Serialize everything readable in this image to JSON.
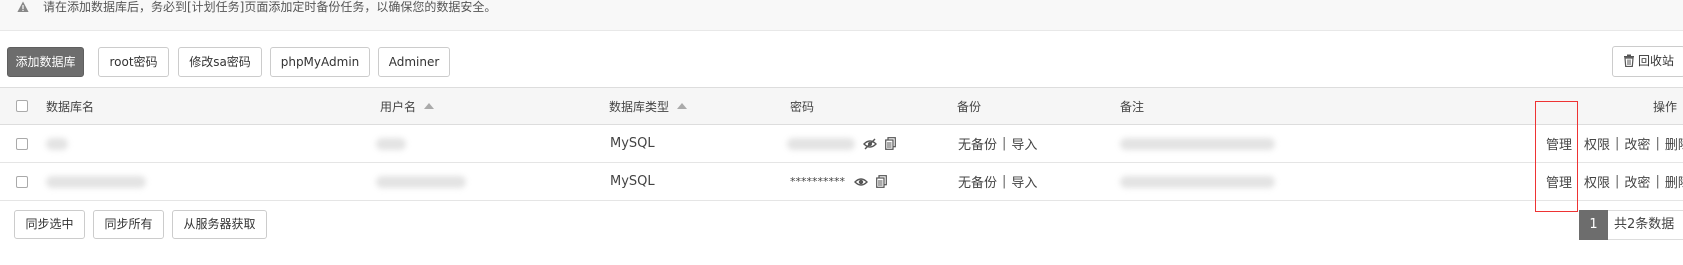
{
  "notice": {
    "icon": "warning-icon",
    "text": "请在添加数据库后，务必到[计划任务]页面添加定时备份任务，以确保您的数据安全。"
  },
  "toolbar": {
    "add_db": "添加数据库",
    "root_pwd": "root密码",
    "sa_pwd": "修改sa密码",
    "phpmyadmin": "phpMyAdmin",
    "adminer": "Adminer",
    "recycle": "回收站",
    "recycle_icon": "trash-icon"
  },
  "table": {
    "headers": {
      "name": "数据库名",
      "user": "用户名",
      "type": "数据库类型",
      "password": "密码",
      "backup": "备份",
      "note": "备注",
      "actions": "操作"
    },
    "rows": [
      {
        "type": "MySQL",
        "password_mask": "",
        "backup": "无备份",
        "import": "导入",
        "manage": "管理",
        "perm": "权限",
        "change_pwd": "改密",
        "delete": "删除"
      },
      {
        "type": "MySQL",
        "password_mask": "**********",
        "backup": "无备份",
        "import": "导入",
        "manage": "管理",
        "perm": "权限",
        "change_pwd": "改密",
        "delete": "删除"
      }
    ]
  },
  "footer": {
    "sync_selected": "同步选中",
    "sync_all": "同步所有",
    "fetch_server": "从服务器获取"
  },
  "pagination": {
    "current": "1",
    "total": "共2条数据"
  },
  "colors": {
    "primary_button": "#6d6d6d",
    "highlight_box": "#ee3333"
  }
}
